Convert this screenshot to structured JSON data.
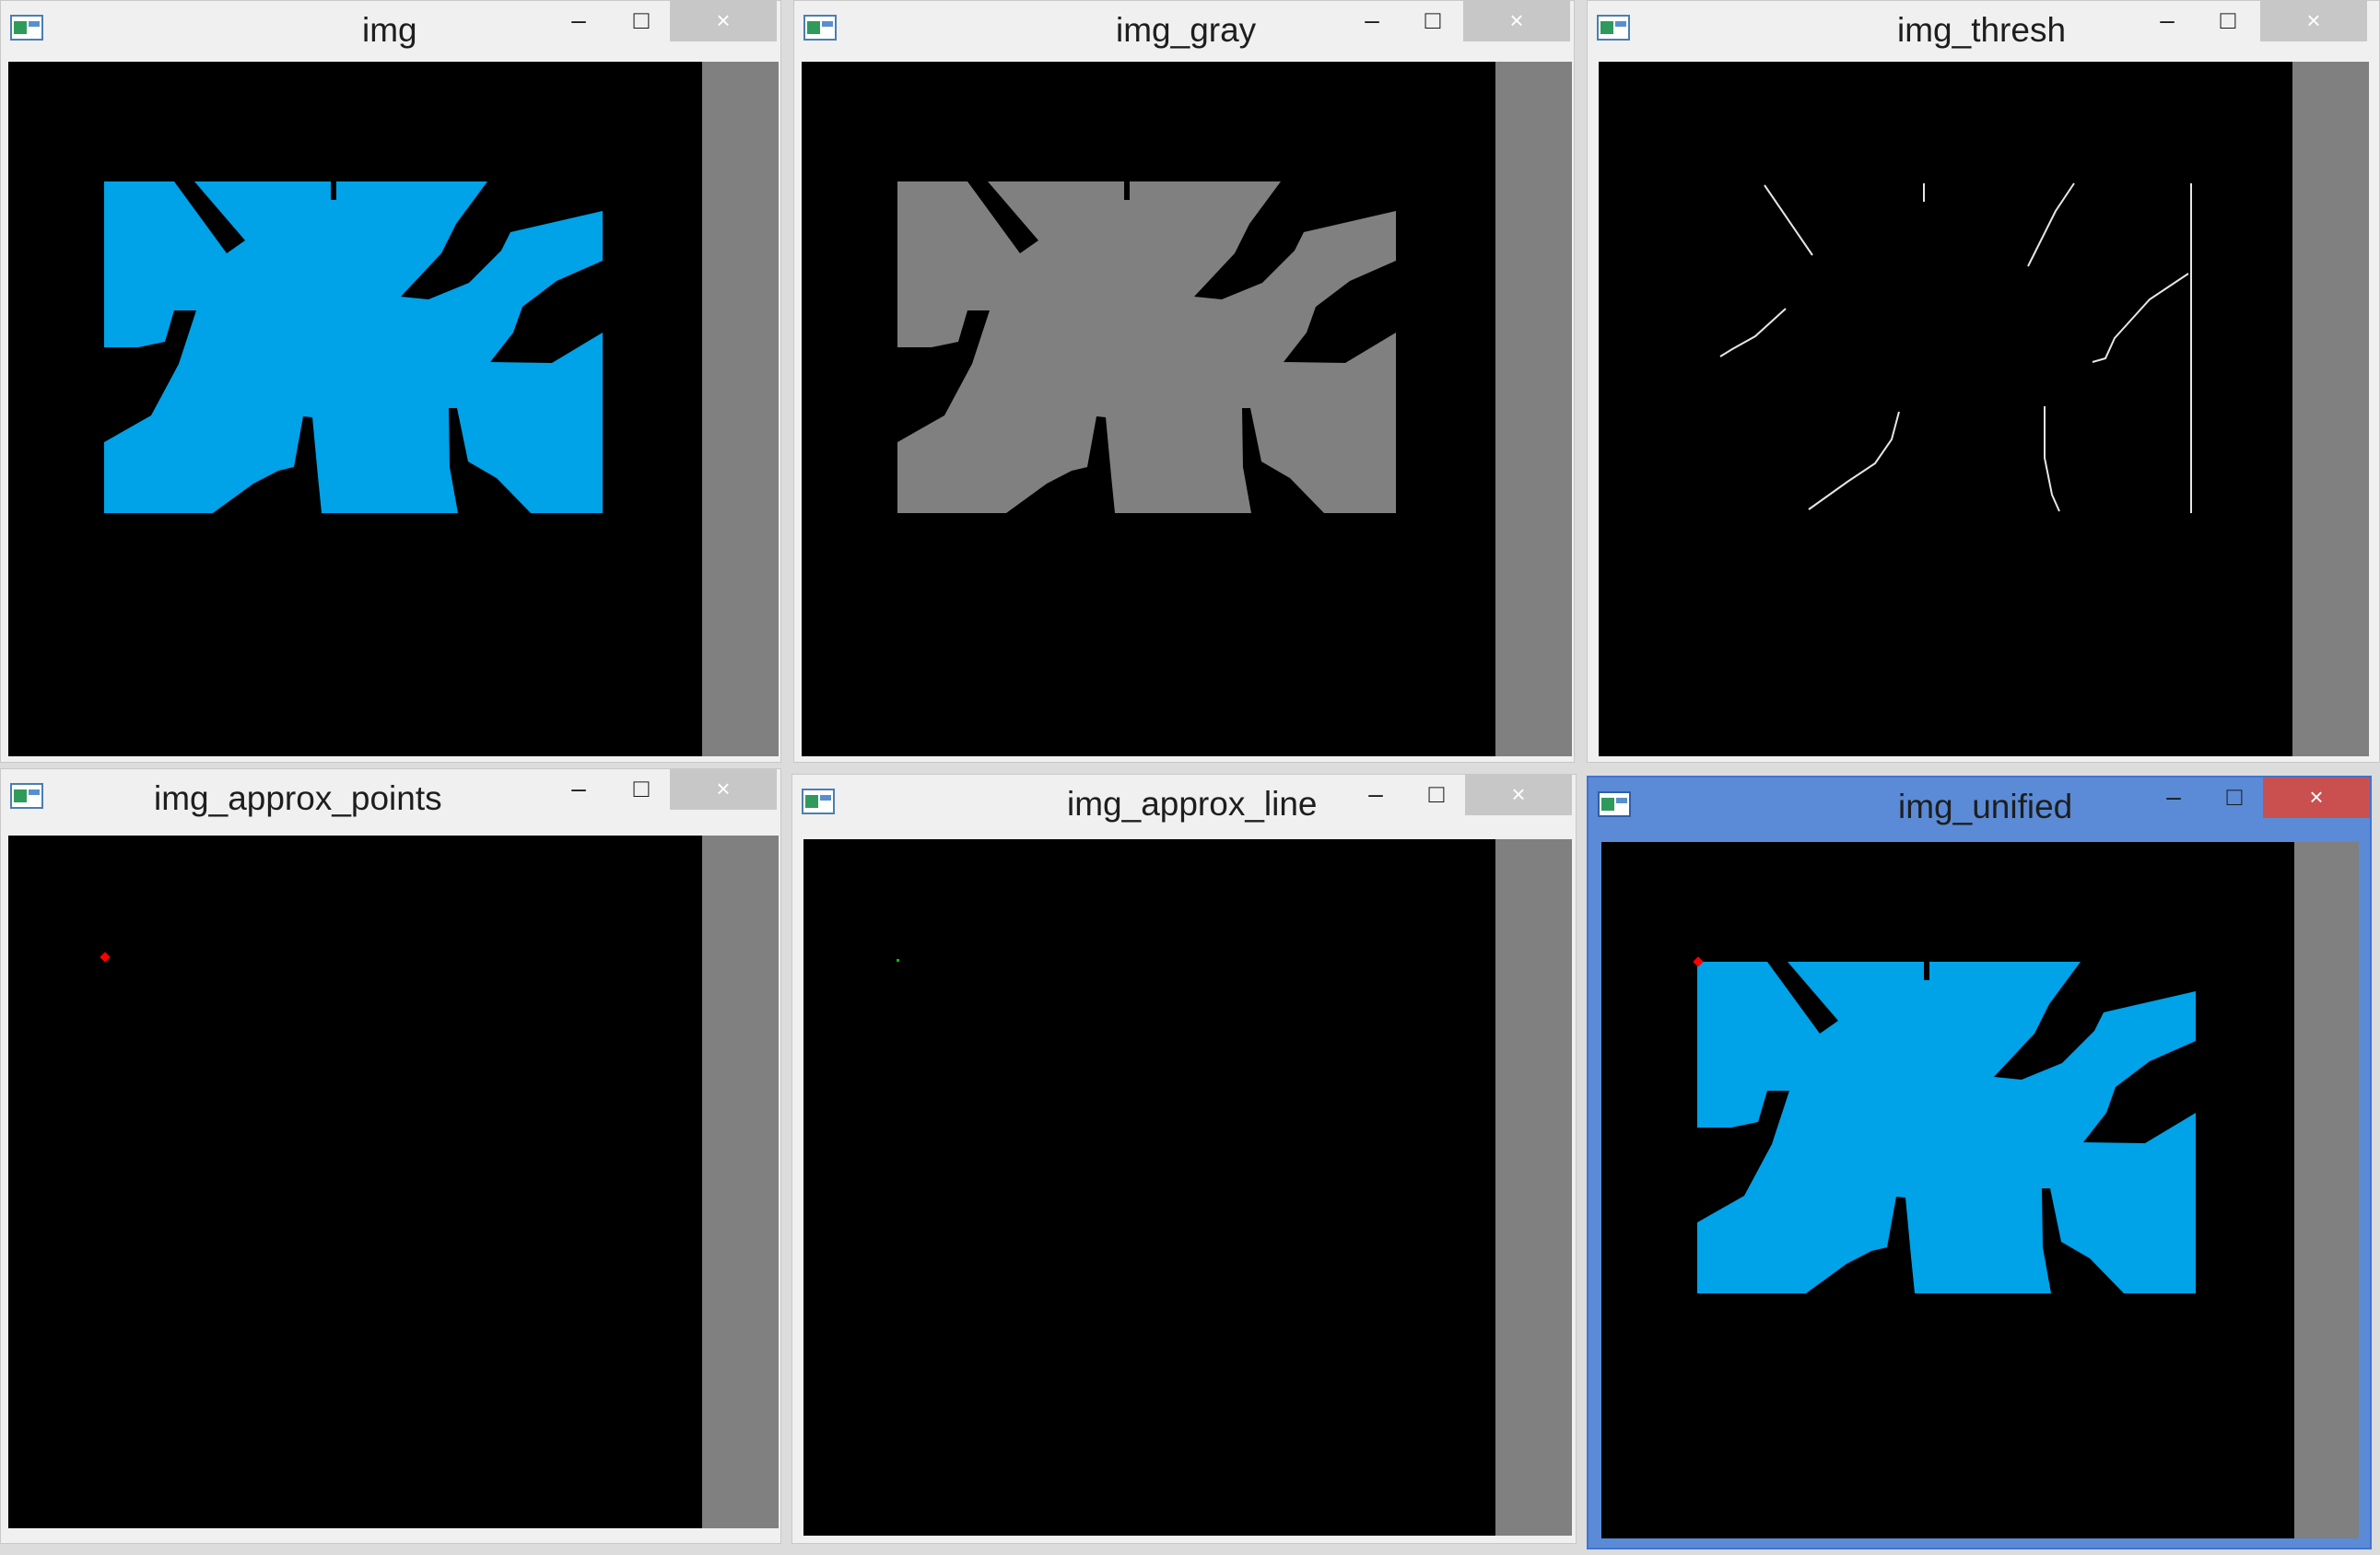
{
  "windows": {
    "img": {
      "title": "img"
    },
    "img_gray": {
      "title": "img_gray"
    },
    "img_thresh": {
      "title": "img_thresh"
    },
    "img_approx_points": {
      "title": "img_approx_points"
    },
    "img_approx_line": {
      "title": "img_approx_line"
    },
    "img_unified": {
      "title": "img_unified"
    }
  },
  "controls": {
    "minimize": "–",
    "maximize": "□",
    "close": "×"
  },
  "colors": {
    "shape_blue": "#00a2e8",
    "shape_gray": "#808080",
    "edge_white": "#e6e6e6",
    "point_red": "#ff0000",
    "point_green": "#00c000",
    "active_frame": "#5b8bd6",
    "close_active": "#c9504f"
  }
}
